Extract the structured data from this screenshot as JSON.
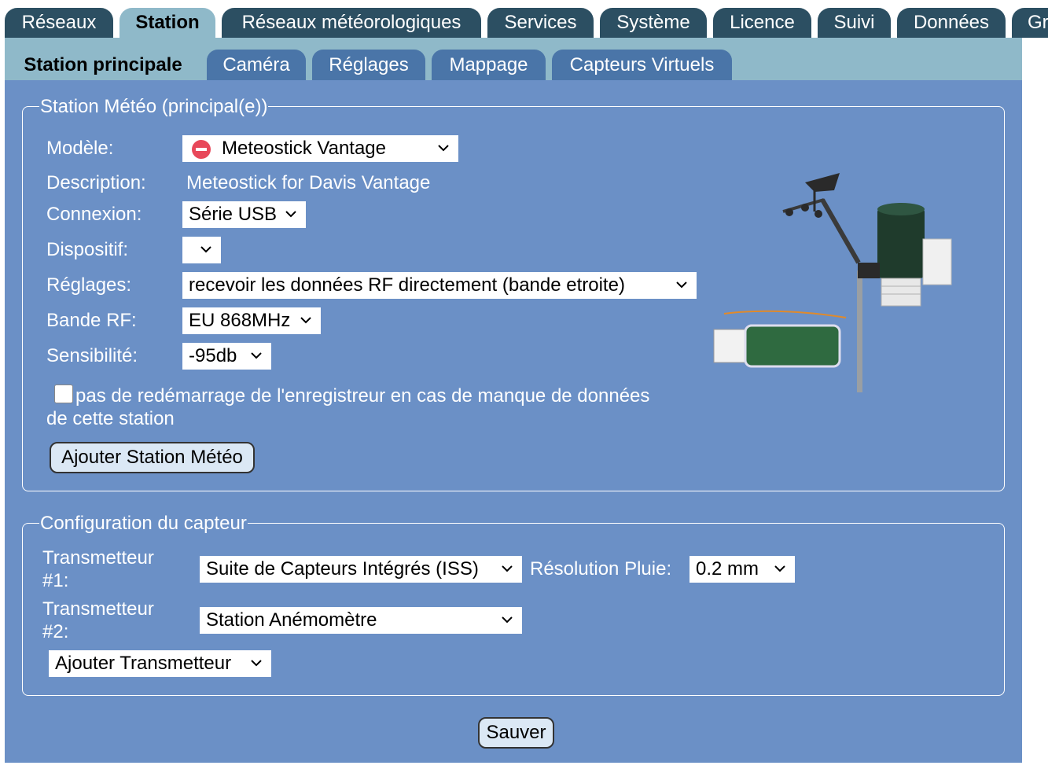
{
  "top_tabs": [
    {
      "label": "Réseaux",
      "active": false
    },
    {
      "label": "Station",
      "active": true
    },
    {
      "label": "Réseaux météorologiques",
      "active": false
    },
    {
      "label": "Services",
      "active": false
    },
    {
      "label": "Système",
      "active": false
    },
    {
      "label": "Licence",
      "active": false
    },
    {
      "label": "Suivi",
      "active": false
    },
    {
      "label": "Données",
      "active": false
    },
    {
      "label": "Gr",
      "active": false
    }
  ],
  "sub_tabs": [
    {
      "label": "Station principale",
      "active": true
    },
    {
      "label": "Caméra",
      "active": false
    },
    {
      "label": "Réglages",
      "active": false
    },
    {
      "label": "Mappage",
      "active": false
    },
    {
      "label": "Capteurs Virtuels",
      "active": false
    }
  ],
  "station": {
    "legend": "Station Météo (principal(e))",
    "model_label": "Modèle:",
    "model_value": "Meteostick Vantage",
    "model_status_icon": "no-entry-icon",
    "description_label": "Description:",
    "description_value": "Meteostick for Davis Vantage",
    "connection_label": "Connexion:",
    "connection_value": "Série USB",
    "device_label": "Dispositif:",
    "device_value": "",
    "settings_label": "Réglages:",
    "settings_value": "recevoir les données RF directement (bande etroite)",
    "rf_band_label": "Bande RF:",
    "rf_band_value": "EU 868MHz",
    "sensitivity_label": "Sensibilité:",
    "sensitivity_value": "-95db",
    "no_restart_checked": false,
    "no_restart_line1": "pas de redémarrage de l'enregistreur en cas de manque de données",
    "no_restart_line2": "de cette station",
    "add_station_button": "Ajouter Station Météo"
  },
  "sensor": {
    "legend": "Configuration du capteur",
    "tx1_label_line1": "Transmetteur",
    "tx1_label_line2": "#1:",
    "tx1_value": "Suite de Capteurs Intégrés (ISS)",
    "rain_label": "Résolution Pluie:",
    "rain_value": "0.2 mm",
    "tx2_label_line1": "Transmetteur",
    "tx2_label_line2": "#2:",
    "tx2_value": "Station Anémomètre",
    "add_transmitter": "Ajouter Transmetteur"
  },
  "save_button": "Sauver",
  "colors": {
    "panel": "#6b90c6",
    "subbar": "#8fb9c9",
    "top_tab": "#2c4f62",
    "sub_tab": "#4a75a8"
  }
}
